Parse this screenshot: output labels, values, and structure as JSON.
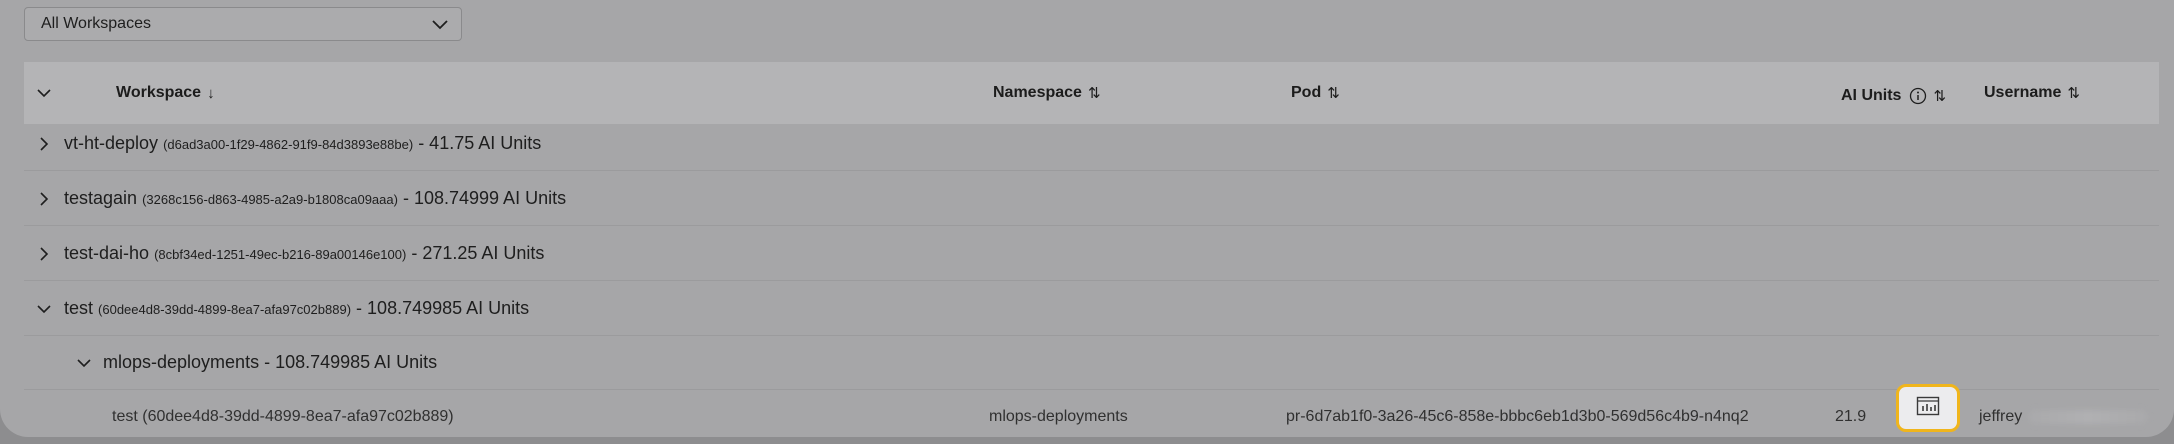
{
  "filter": {
    "selected": "All Workspaces"
  },
  "table": {
    "headers": {
      "workspace": "Workspace",
      "workspace_sort": "↓",
      "namespace": "Namespace",
      "namespace_sort": "⇅",
      "pod": "Pod",
      "pod_sort": "⇅",
      "ai_units": "AI Units",
      "ai_units_sort": "⇅",
      "username": "Username",
      "username_sort": "⇅"
    },
    "groups": [
      {
        "name": "vt-ht-deploy",
        "id": "(d6ad3a00-1f29-4862-91f9-84d3893e88be)",
        "total": "- 41.75 AI Units"
      },
      {
        "name": "testagain",
        "id": "(3268c156-d863-4985-a2a9-b1808ca09aaa)",
        "total": "- 108.74999 AI Units"
      },
      {
        "name": "test-dai-ho",
        "id": "(8cbf34ed-1251-49ec-b216-89a00146e100)",
        "total": "- 271.25 AI Units"
      },
      {
        "name": "test",
        "id": "(60dee4d8-39dd-4899-8ea7-afa97c02b889)",
        "total": "- 108.749985 AI Units"
      }
    ],
    "subgroup": {
      "label": "mlops-deployments - 108.749985 AI Units"
    },
    "leaf": {
      "workspace": "test (60dee4d8-39dd-4899-8ea7-afa97c02b889)",
      "namespace": "mlops-deployments",
      "pod": "pr-6d7ab1f0-3a26-45c6-858e-bbbc6eb1d3b0-569d56c4b9-n4nq2",
      "ai_units": "21.9",
      "username": "jeffrey"
    }
  },
  "colors": {
    "highlight": "#f0b51c"
  }
}
